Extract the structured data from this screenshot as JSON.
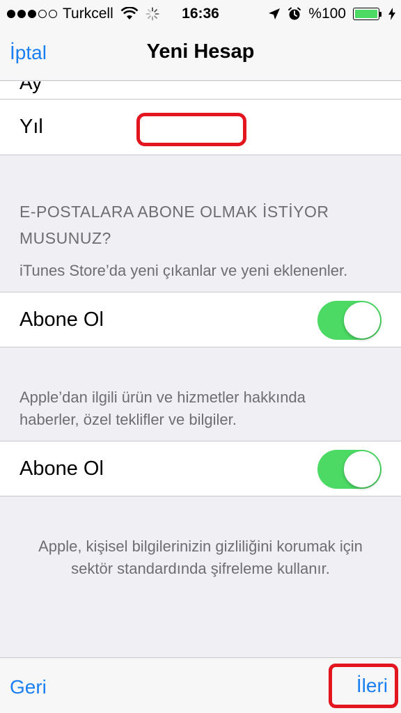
{
  "status_bar": {
    "carrier": "Turkcell",
    "time": "16:36",
    "battery": "%100",
    "battery_level": 1.0,
    "icons": [
      "signal-icon",
      "wifi-icon",
      "activity-spinner-icon",
      "location-arrow-icon",
      "alarm-icon",
      "battery-icon",
      "charging-icon"
    ]
  },
  "nav": {
    "cancel_label": "İptal",
    "title": "Yeni Hesap"
  },
  "form": {
    "year_label": "Yıl",
    "year_value": ""
  },
  "email_section": {
    "header": "E-POSTALARA ABONE OLMAK İSTİYOR MUSUNUZ?",
    "itunes_desc": "iTunes Store’da yeni çıkanlar ve yeni eklenenler.",
    "itunes_toggle_label": "Abone Ol",
    "itunes_toggle_on": true,
    "apple_desc": "Apple’dan ilgili ürün ve hizmetler hakkında haberler, özel teklifler ve bilgiler.",
    "apple_toggle_label": "Abone Ol",
    "apple_toggle_on": true
  },
  "privacy_note": "Apple, kişisel bilgilerinizin gizliliğini korumak için sektör standardında şifreleme kullanır.",
  "toolbar": {
    "back_label": "Geri",
    "next_label": "İleri"
  },
  "colors": {
    "accent": "#1a7ff2",
    "toggle_on": "#4cd964",
    "highlight": "#e3161f",
    "background": "#efeff4"
  }
}
